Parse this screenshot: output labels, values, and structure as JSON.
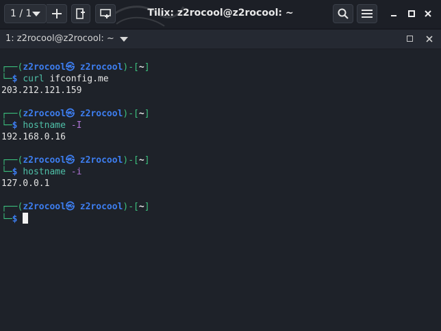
{
  "header": {
    "session_label": "1 / 1",
    "title": "Tilix: z2rocool@z2rocool: ~"
  },
  "terminal_titlebar": {
    "title": "1: z2rocool@z2rocool: ~"
  },
  "prompt": {
    "top_corner": "┌──(",
    "user": "z2rocool",
    "at_symbol": "㉿",
    "host": "z2rocool",
    "mid": ")-[",
    "dir": "~",
    "end": "]",
    "bottom_corner": "└─",
    "dollar": "$"
  },
  "commands": [
    {
      "cmd": "curl",
      "args": "ifconfig.me",
      "flag": "",
      "output": "203.212.121.159"
    },
    {
      "cmd": "hostname",
      "args": "",
      "flag": "-I",
      "output": "192.168.0.16"
    },
    {
      "cmd": "hostname",
      "args": "",
      "flag": "-i",
      "output": "127.0.0.1"
    }
  ],
  "icons": {
    "session_caret": "chevron-down-icon",
    "add": "plus-icon",
    "split": "add-terminal-icon",
    "sync": "sync-input-icon",
    "search": "search-icon",
    "menu": "hamburger-menu-icon",
    "minimize": "minimize-icon",
    "maximize": "maximize-icon",
    "close": "close-icon"
  },
  "colors": {
    "background": "#1e2229",
    "prompt_frame": "#3cc37f",
    "prompt_user": "#3d7ef0",
    "command": "#4fc0a8",
    "flag": "#b074d6"
  }
}
